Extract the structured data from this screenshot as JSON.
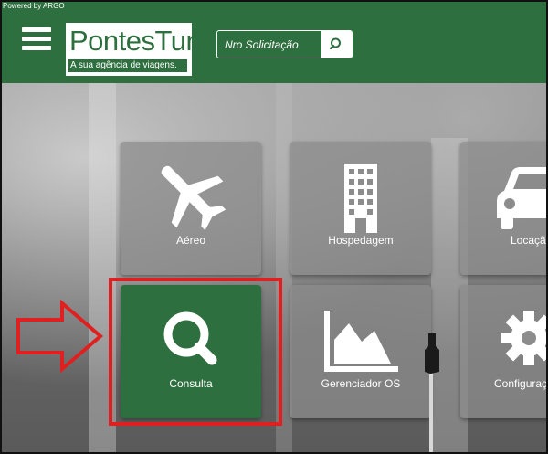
{
  "powered_by": "Powered by ARGO",
  "brand": {
    "name": "PontesTur",
    "tagline": "A sua agência de viagens."
  },
  "search": {
    "placeholder": "Nro Solicitação"
  },
  "tiles": [
    {
      "label": "Aéreo",
      "icon": "airplane-icon"
    },
    {
      "label": "Hospedagem",
      "icon": "building-icon"
    },
    {
      "label": "Locação",
      "icon": "car-icon"
    },
    {
      "label": "Consulta",
      "icon": "search-icon",
      "active": true
    },
    {
      "label": "Gerenciador OS",
      "icon": "area-chart-icon"
    },
    {
      "label": "Configuração",
      "icon": "gear-icon"
    }
  ],
  "colors": {
    "brand_green": "#2e6f3f",
    "highlight_red": "#e02020",
    "tile_gray": "#8c8c8c"
  }
}
